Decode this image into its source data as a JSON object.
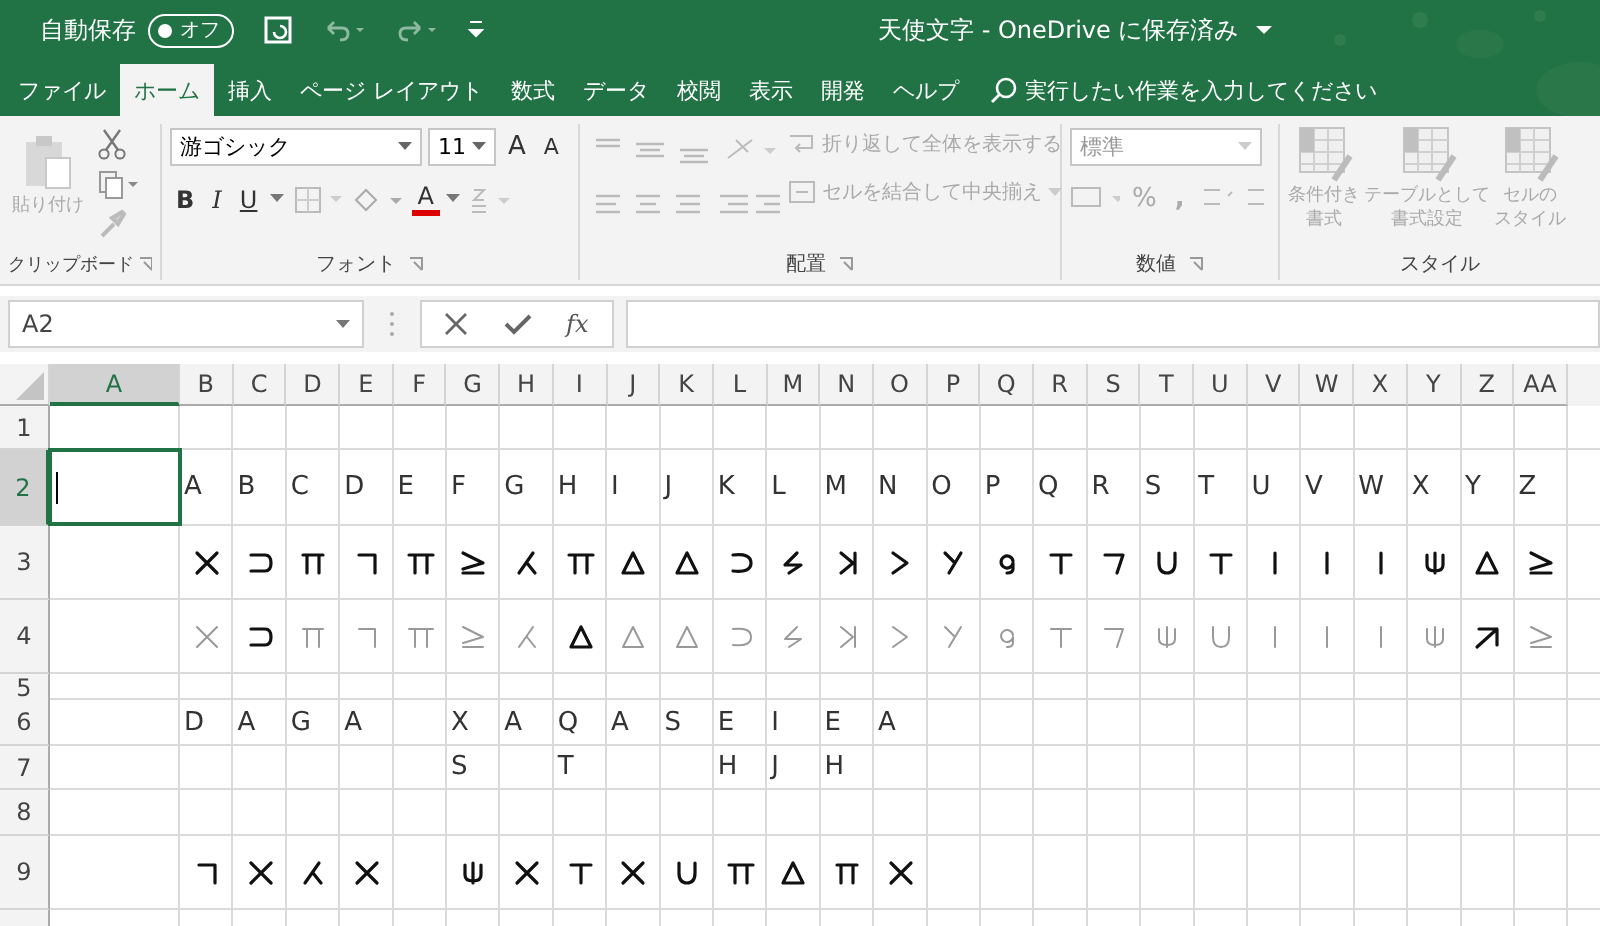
{
  "title_bar": {
    "autosave_label": "自動保存",
    "autosave_state": "オフ",
    "autosave_on": false,
    "title": "天使文字 - OneDrive に保存済み"
  },
  "tabs": [
    {
      "label": "ファイル",
      "selected": false
    },
    {
      "label": "ホーム",
      "selected": true
    },
    {
      "label": "挿入",
      "selected": false
    },
    {
      "label": "ページ レイアウト",
      "selected": false
    },
    {
      "label": "数式",
      "selected": false
    },
    {
      "label": "データ",
      "selected": false
    },
    {
      "label": "校閲",
      "selected": false
    },
    {
      "label": "表示",
      "selected": false
    },
    {
      "label": "開発",
      "selected": false
    },
    {
      "label": "ヘルプ",
      "selected": false
    }
  ],
  "tell_me": {
    "placeholder": "実行したい作業を入力してください"
  },
  "ribbon": {
    "clipboard": {
      "paste": "貼り付け",
      "label": "クリップボード"
    },
    "font": {
      "font_name": "游ゴシック",
      "font_size": "11",
      "grow": "A",
      "shrink": "A",
      "bold": "B",
      "italic": "I",
      "underline": "U",
      "font_color": "A",
      "label": "フォント"
    },
    "alignment": {
      "wrap": "折り返して全体を表示する",
      "merge": "セルを結合して中央揃え",
      "label": "配置"
    },
    "number": {
      "format": "標準",
      "percent": "%",
      "comma": ",",
      "label": "数値"
    },
    "styles": {
      "buttons": [
        {
          "lines": [
            "条件付き",
            "書式"
          ]
        },
        {
          "lines": [
            "テーブルとして",
            "書式設定"
          ]
        },
        {
          "lines": [
            "セルの",
            "スタイル"
          ]
        }
      ],
      "label": "スタイル"
    }
  },
  "formula_bar": {
    "name_box": "A2",
    "fx": "fx"
  },
  "columns": [
    {
      "label": "A",
      "selected": true
    },
    {
      "label": "B",
      "selected": false
    },
    {
      "label": "C",
      "selected": false
    },
    {
      "label": "D",
      "selected": false
    },
    {
      "label": "E",
      "selected": false
    },
    {
      "label": "F",
      "selected": false
    },
    {
      "label": "G",
      "selected": false
    },
    {
      "label": "H",
      "selected": false
    },
    {
      "label": "I",
      "selected": false
    },
    {
      "label": "J",
      "selected": false
    },
    {
      "label": "K",
      "selected": false
    },
    {
      "label": "L",
      "selected": false
    },
    {
      "label": "M",
      "selected": false
    },
    {
      "label": "N",
      "selected": false
    },
    {
      "label": "O",
      "selected": false
    },
    {
      "label": "P",
      "selected": false
    },
    {
      "label": "Q",
      "selected": false
    },
    {
      "label": "R",
      "selected": false
    },
    {
      "label": "S",
      "selected": false
    },
    {
      "label": "T",
      "selected": false
    },
    {
      "label": "U",
      "selected": false
    },
    {
      "label": "V",
      "selected": false
    },
    {
      "label": "W",
      "selected": false
    },
    {
      "label": "X",
      "selected": false
    },
    {
      "label": "Y",
      "selected": false
    },
    {
      "label": "Z",
      "selected": false
    },
    {
      "label": "AA",
      "selected": false
    }
  ],
  "rows": [
    {
      "label": "1",
      "selected": false,
      "cells": []
    },
    {
      "label": "2",
      "selected": true,
      "cells": [
        {
          "kind": "active"
        },
        {
          "kind": "text",
          "text": "A"
        },
        {
          "kind": "text",
          "text": "B"
        },
        {
          "kind": "text",
          "text": "C"
        },
        {
          "kind": "text",
          "text": "D"
        },
        {
          "kind": "text",
          "text": "E"
        },
        {
          "kind": "text",
          "text": "F"
        },
        {
          "kind": "text",
          "text": "G"
        },
        {
          "kind": "text",
          "text": "H"
        },
        {
          "kind": "text",
          "text": "I"
        },
        {
          "kind": "text",
          "text": "J"
        },
        {
          "kind": "text",
          "text": "K"
        },
        {
          "kind": "text",
          "text": "L"
        },
        {
          "kind": "text",
          "text": "M"
        },
        {
          "kind": "text",
          "text": "N"
        },
        {
          "kind": "text",
          "text": "O"
        },
        {
          "kind": "text",
          "text": "P"
        },
        {
          "kind": "text",
          "text": "Q"
        },
        {
          "kind": "text",
          "text": "R"
        },
        {
          "kind": "text",
          "text": "S"
        },
        {
          "kind": "text",
          "text": "T"
        },
        {
          "kind": "text",
          "text": "U"
        },
        {
          "kind": "text",
          "text": "V"
        },
        {
          "kind": "text",
          "text": "W"
        },
        {
          "kind": "text",
          "text": "X"
        },
        {
          "kind": "text",
          "text": "Y"
        },
        {
          "kind": "text",
          "text": "Z"
        }
      ]
    },
    {
      "label": "3",
      "selected": false,
      "cells": [
        {
          "kind": "empty"
        },
        {
          "kind": "glyph",
          "faint": false
        },
        {
          "kind": "glyph",
          "faint": false
        },
        {
          "kind": "glyph",
          "faint": false
        },
        {
          "kind": "glyph",
          "faint": false
        },
        {
          "kind": "glyph",
          "faint": false
        },
        {
          "kind": "glyph",
          "faint": false
        },
        {
          "kind": "glyph",
          "faint": false
        },
        {
          "kind": "glyph",
          "faint": false
        },
        {
          "kind": "glyph",
          "faint": false
        },
        {
          "kind": "glyph",
          "faint": false
        },
        {
          "kind": "glyph",
          "faint": false
        },
        {
          "kind": "glyph",
          "faint": false
        },
        {
          "kind": "glyph",
          "faint": false
        },
        {
          "kind": "glyph",
          "faint": false
        },
        {
          "kind": "glyph",
          "faint": false
        },
        {
          "kind": "glyph",
          "faint": false
        },
        {
          "kind": "glyph",
          "faint": false
        },
        {
          "kind": "glyph",
          "faint": false
        },
        {
          "kind": "glyph",
          "faint": false
        },
        {
          "kind": "glyph",
          "faint": false
        },
        {
          "kind": "glyph",
          "faint": false
        },
        {
          "kind": "glyph",
          "faint": false
        },
        {
          "kind": "glyph",
          "faint": false
        },
        {
          "kind": "glyph",
          "faint": false
        },
        {
          "kind": "glyph",
          "faint": false
        },
        {
          "kind": "glyph",
          "faint": false
        }
      ]
    },
    {
      "label": "4",
      "selected": false,
      "cells": [
        {
          "kind": "empty"
        },
        {
          "kind": "glyph",
          "faint": true
        },
        {
          "kind": "glyph",
          "faint": false
        },
        {
          "kind": "glyph",
          "faint": true
        },
        {
          "kind": "glyph",
          "faint": true
        },
        {
          "kind": "glyph",
          "faint": true
        },
        {
          "kind": "glyph",
          "faint": true
        },
        {
          "kind": "glyph",
          "faint": true
        },
        {
          "kind": "glyph",
          "faint": false
        },
        {
          "kind": "glyph",
          "faint": true
        },
        {
          "kind": "glyph",
          "faint": true
        },
        {
          "kind": "glyph",
          "faint": true
        },
        {
          "kind": "glyph",
          "faint": true
        },
        {
          "kind": "glyph",
          "faint": true
        },
        {
          "kind": "glyph",
          "faint": true
        },
        {
          "kind": "glyph",
          "faint": true
        },
        {
          "kind": "glyph",
          "faint": true
        },
        {
          "kind": "glyph",
          "faint": true
        },
        {
          "kind": "glyph",
          "faint": true
        },
        {
          "kind": "glyph",
          "faint": true
        },
        {
          "kind": "glyph",
          "faint": true
        },
        {
          "kind": "glyph",
          "faint": true
        },
        {
          "kind": "glyph",
          "faint": true
        },
        {
          "kind": "glyph",
          "faint": true
        },
        {
          "kind": "glyph",
          "faint": true
        },
        {
          "kind": "glyph",
          "faint": false
        },
        {
          "kind": "glyph",
          "faint": true
        }
      ]
    },
    {
      "label": "5",
      "selected": false,
      "cells": []
    },
    {
      "label": "6",
      "selected": false,
      "cells": [
        {
          "kind": "empty"
        },
        {
          "kind": "text",
          "text": "D"
        },
        {
          "kind": "text",
          "text": "A"
        },
        {
          "kind": "text",
          "text": "G"
        },
        {
          "kind": "text",
          "text": "A"
        },
        {
          "kind": "empty"
        },
        {
          "kind": "text",
          "text": "X"
        },
        {
          "kind": "text",
          "text": "A"
        },
        {
          "kind": "text",
          "text": "Q"
        },
        {
          "kind": "text",
          "text": "A"
        },
        {
          "kind": "text",
          "text": "S"
        },
        {
          "kind": "text",
          "text": "E"
        },
        {
          "kind": "text",
          "text": "I"
        },
        {
          "kind": "text",
          "text": "E"
        },
        {
          "kind": "text",
          "text": "A"
        }
      ]
    },
    {
      "label": "7",
      "selected": false,
      "cells": [
        {
          "kind": "empty"
        },
        {
          "kind": "empty"
        },
        {
          "kind": "empty"
        },
        {
          "kind": "empty"
        },
        {
          "kind": "empty"
        },
        {
          "kind": "empty"
        },
        {
          "kind": "text",
          "text": "S"
        },
        {
          "kind": "empty"
        },
        {
          "kind": "text",
          "text": "T"
        },
        {
          "kind": "empty"
        },
        {
          "kind": "empty"
        },
        {
          "kind": "text",
          "text": "H"
        },
        {
          "kind": "text",
          "text": "J"
        },
        {
          "kind": "text",
          "text": "H"
        }
      ]
    },
    {
      "label": "8",
      "selected": false,
      "cells": []
    },
    {
      "label": "9",
      "selected": false,
      "cells": [
        {
          "kind": "empty"
        },
        {
          "kind": "glyph",
          "faint": false
        },
        {
          "kind": "glyph",
          "faint": false
        },
        {
          "kind": "glyph",
          "faint": false
        },
        {
          "kind": "glyph",
          "faint": false
        },
        {
          "kind": "empty"
        },
        {
          "kind": "glyph",
          "faint": false
        },
        {
          "kind": "glyph",
          "faint": false
        },
        {
          "kind": "glyph",
          "faint": false
        },
        {
          "kind": "glyph",
          "faint": false
        },
        {
          "kind": "glyph",
          "faint": false
        },
        {
          "kind": "glyph",
          "faint": false
        },
        {
          "kind": "glyph",
          "faint": false
        },
        {
          "kind": "glyph",
          "faint": false
        },
        {
          "kind": "glyph",
          "faint": false
        }
      ]
    },
    {
      "selected": false,
      "cells": []
    }
  ]
}
